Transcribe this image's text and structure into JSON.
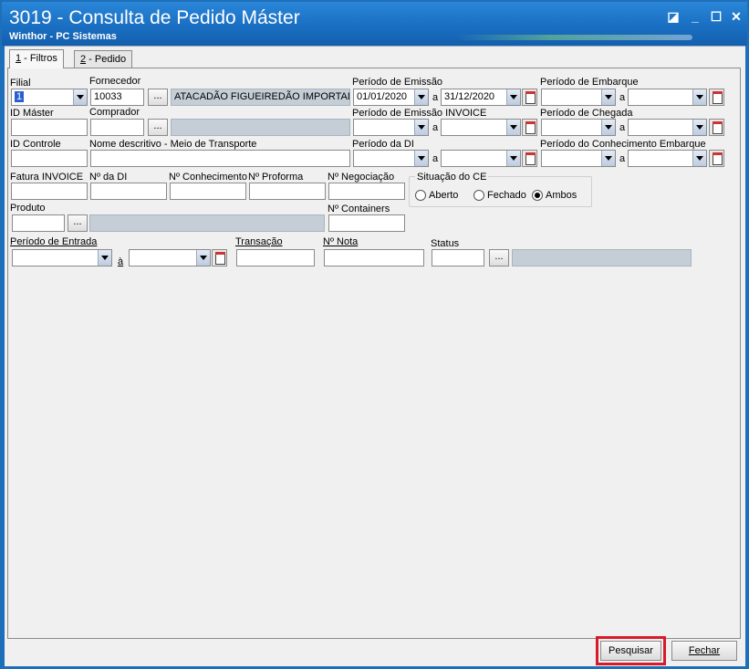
{
  "window": {
    "title": "3019 - Consulta de Pedido Máster",
    "subtitle": "Winthor - PC Sistemas",
    "controls": {
      "restore": "◪",
      "minimize": "_",
      "maximize": "☐",
      "close": "✕"
    }
  },
  "tabs": [
    {
      "key": "1",
      "label": " - Filtros"
    },
    {
      "key": "2",
      "label": " - Pedido"
    }
  ],
  "filters": {
    "filial": {
      "label": "Filial",
      "value": "1"
    },
    "fornecedor": {
      "label": "Fornecedor",
      "code": "10033",
      "name": "ATACADÃO FIGUEIREDÃO IMPORTADÃO"
    },
    "id_master": {
      "label": "ID Máster",
      "value": ""
    },
    "comprador": {
      "label": "Comprador",
      "code": "",
      "name": ""
    },
    "id_controle": {
      "label": "ID Controle",
      "value": ""
    },
    "nome_descritivo": {
      "label": "Nome descritivo - Meio de Transporte",
      "value": ""
    },
    "periodo_emissao": {
      "label": "Período de Emissão",
      "from": "01/01/2020",
      "to": "31/12/2020"
    },
    "periodo_emissao_invoice": {
      "label": "Período de Emissão INVOICE",
      "from": "",
      "to": ""
    },
    "periodo_di": {
      "label": "Período da DI",
      "from": "",
      "to": ""
    },
    "periodo_embarque": {
      "label": "Período de Embarque",
      "from": "",
      "to": ""
    },
    "periodo_chegada": {
      "label": "Período de Chegada",
      "from": "",
      "to": ""
    },
    "periodo_conhecimento": {
      "label": "Período do Conhecimento Embarque",
      "from": "",
      "to": ""
    },
    "range_sep": "a",
    "fatura_invoice": {
      "label": "Fatura INVOICE",
      "value": ""
    },
    "num_di": {
      "label": "Nº da DI",
      "value": ""
    },
    "num_conhecimento": {
      "label": "Nº Conhecimento",
      "value": ""
    },
    "num_proforma": {
      "label": "Nº Proforma",
      "value": ""
    },
    "num_negociacao": {
      "label": "Nº Negociação",
      "value": ""
    },
    "num_containers": {
      "label": "Nº Containers",
      "value": ""
    },
    "situacao_ce": {
      "label": "Situação do CE",
      "options": [
        "Aberto",
        "Fechado",
        "Ambos"
      ],
      "selected": "Ambos"
    },
    "produto": {
      "label": "Produto",
      "code": "",
      "name": ""
    },
    "periodo_entrada": {
      "label": "Período de Entrada",
      "from": "",
      "to": "",
      "sep": "à"
    },
    "transacao": {
      "label": "Transação",
      "value": ""
    },
    "num_nota": {
      "label": "Nº Nota",
      "value": ""
    },
    "status": {
      "label": "Status",
      "code": "",
      "name": ""
    },
    "browse_label": "..."
  },
  "footer": {
    "search_label": "Pesquisar",
    "close_label": "Fechar",
    "highlight_color": "#d81b2a"
  }
}
